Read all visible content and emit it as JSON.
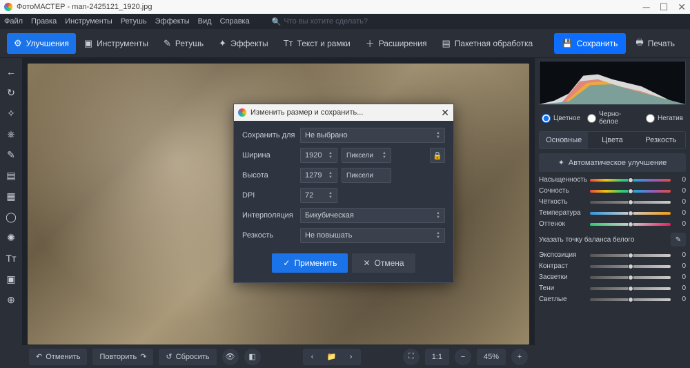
{
  "title": "ФотоМАСТЕР - man-2425121_1920.jpg",
  "menu": {
    "file": "Файл",
    "edit": "Правка",
    "tools": "Инструменты",
    "retouch": "Ретушь",
    "effects": "Эффекты",
    "view": "Вид",
    "help": "Справка",
    "search": "Что вы хотите сделать?"
  },
  "toolbar": {
    "enhance": "Улучшения",
    "tools": "Инструменты",
    "retouch": "Ретушь",
    "effects": "Эффекты",
    "text": "Текст и рамки",
    "extensions": "Расширения",
    "batch": "Пакетная обработка",
    "save": "Сохранить",
    "print": "Печать"
  },
  "bottom": {
    "undo": "Отменить",
    "redo": "Повторить",
    "reset": "Сбросить",
    "zoom": "45%",
    "scale11": "1:1"
  },
  "colormode": {
    "color": "Цветное",
    "bw": "Черно-белое",
    "neg": "Негатив"
  },
  "rtabs": {
    "basic": "Основные",
    "colors": "Цвета",
    "sharp": "Резкость"
  },
  "auto": "Автоматическое улучшение",
  "sliders": {
    "saturation": {
      "label": "Насыщенность",
      "value": "0"
    },
    "vibrance": {
      "label": "Сочность",
      "value": "0"
    },
    "clarity": {
      "label": "Чёткость",
      "value": "0"
    },
    "temperature": {
      "label": "Температура",
      "value": "0"
    },
    "tint": {
      "label": "Оттенок",
      "value": "0"
    },
    "exposure": {
      "label": "Экспозиция",
      "value": "0"
    },
    "contrast": {
      "label": "Контраст",
      "value": "0"
    },
    "highlights": {
      "label": "Засветки",
      "value": "0"
    },
    "shadows": {
      "label": "Тени",
      "value": "0"
    },
    "whites": {
      "label": "Светлые",
      "value": "0"
    }
  },
  "wb": "Указать точку баланса белого",
  "dialog": {
    "title": "Изменить размер и сохранить...",
    "savefor": {
      "label": "Сохранить для",
      "value": "Не выбрано"
    },
    "width": {
      "label": "Ширина",
      "value": "1920",
      "unit": "Пиксели"
    },
    "height": {
      "label": "Высота",
      "value": "1279",
      "unit": "Пиксели"
    },
    "dpi": {
      "label": "DPI",
      "value": "72"
    },
    "interp": {
      "label": "Интерполяция",
      "value": "Бикубическая"
    },
    "sharp": {
      "label": "Резкость",
      "value": "Не повышать"
    },
    "apply": "Применить",
    "cancel": "Отмена"
  }
}
